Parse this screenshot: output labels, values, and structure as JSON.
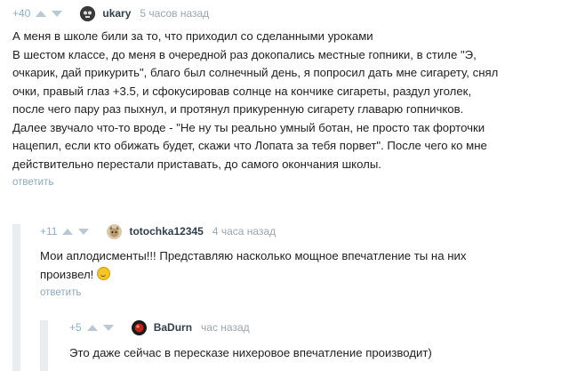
{
  "comments": [
    {
      "rating": "+40",
      "author": "ukary",
      "time": "5 часов назад",
      "lines": [
        "А меня в школе били за то, что приходил со сделанными уроками",
        "В шестом классе, до меня в очередной раз докопались местные гопники, в стиле \"Э,",
        "очкарик, дай прикурить\", благо был солнечный день, я попросил дать мне сигарету, снял",
        "очки, правый глаз +3.5, и сфокусировав солнце на кончике сигареты, раздул уголек,",
        "после чего пару раз пыхнул, и протянул прикуренную сигарету главарю гопничков.",
        "Далее звучало что-то вроде - \"Не ну ты реально умный ботан, не просто так форточки",
        "нацепил, если кто обижать будет, скажи что Лопата за тебя порвет\". После чего ко мне",
        "действительно перестали приставать, до самого окончания школы."
      ],
      "reply_label": "ответить",
      "avatar_icon": "skull-avatar-icon"
    },
    {
      "rating": "+11",
      "author": "totochka12345",
      "time": "4 часа назад",
      "lines": [
        "Мои аплодисменты!!! Представляю насколько мощное впечатление ты на них",
        "произвел!"
      ],
      "emoji_icon": "laughing-emoji-icon",
      "reply_label": "ответить",
      "avatar_icon": "cat-avatar-icon"
    },
    {
      "rating": "+5",
      "author": "BaDurn",
      "time": "час назад",
      "lines": [
        "Это даже сейчас в пересказе нихеровое впечатление производит)"
      ],
      "avatar_icon": "red-orb-avatar-icon"
    }
  ],
  "colors": {
    "rating": "#8ab0c5",
    "arrow": "#b8c9d4",
    "author": "#2f3f4d",
    "time": "#9aa6ae",
    "reply": "#8da8ba",
    "branch": "#e9edf0"
  }
}
